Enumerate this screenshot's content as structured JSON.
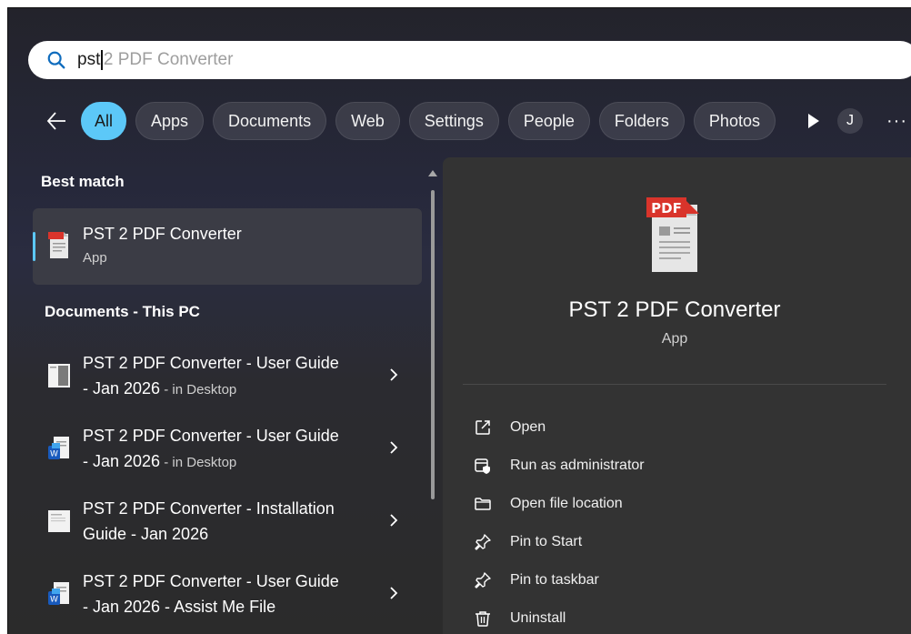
{
  "search": {
    "query_typed": "pst",
    "query_suggestion": "2 PDF Converter"
  },
  "filters": {
    "items": [
      "All",
      "Apps",
      "Documents",
      "Web",
      "Settings",
      "People",
      "Folders",
      "Photos"
    ],
    "active": "All",
    "avatar_initial": "J",
    "more_label": "···"
  },
  "best_match": {
    "section_label": "Best match",
    "title": "PST 2 PDF Converter",
    "subtitle": "App"
  },
  "documents": {
    "section_label": "Documents - This PC",
    "items": [
      {
        "line1": "PST 2 PDF Converter - User Guide",
        "line2": "- Jan 2026",
        "location": " - in Desktop",
        "icon": "pdf-document-icon"
      },
      {
        "line1": "PST 2 PDF Converter - User Guide",
        "line2": "- Jan 2026",
        "location": " - in Desktop",
        "icon": "word-document-icon"
      },
      {
        "line1": "PST 2 PDF Converter - Installation",
        "line2": "Guide - Jan 2026",
        "location": "",
        "icon": "text-document-icon"
      },
      {
        "line1": "PST 2 PDF Converter - User Guide",
        "line2": "- Jan 2026 - Assist Me File",
        "location": "",
        "icon": "word-document-icon"
      }
    ]
  },
  "details": {
    "app_name": "PST 2 PDF Converter",
    "app_type": "App",
    "icon_label": "PDF",
    "actions": [
      {
        "label": "Open",
        "icon": "open-external-icon"
      },
      {
        "label": "Run as administrator",
        "icon": "admin-shield-icon"
      },
      {
        "label": "Open file location",
        "icon": "folder-icon"
      },
      {
        "label": "Pin to Start",
        "icon": "pin-icon"
      },
      {
        "label": "Pin to taskbar",
        "icon": "pin-icon"
      },
      {
        "label": "Uninstall",
        "icon": "trash-icon"
      }
    ]
  },
  "colors": {
    "accent": "#5cc8f8",
    "pdf_red": "#d9342b"
  }
}
